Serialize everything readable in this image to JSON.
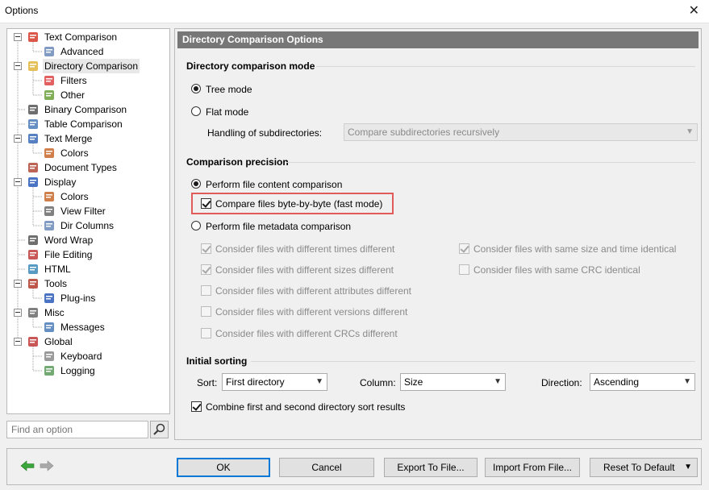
{
  "window": {
    "title": "Options",
    "close_glyph": "✕"
  },
  "tree": {
    "items": [
      {
        "label": "Text Comparison",
        "icon": "text-comparison-icon"
      },
      {
        "label": "Advanced",
        "icon": "advanced-settings-icon"
      },
      {
        "label": "Directory Comparison",
        "icon": "directory-comparison-icon",
        "selected": true
      },
      {
        "label": "Filters",
        "icon": "filter-icon"
      },
      {
        "label": "Other",
        "icon": "other-folder-icon"
      },
      {
        "label": "Binary Comparison",
        "icon": "binary-comparison-icon"
      },
      {
        "label": "Table Comparison",
        "icon": "table-comparison-icon"
      },
      {
        "label": "Text Merge",
        "icon": "text-merge-icon"
      },
      {
        "label": "Colors",
        "icon": "palette-icon"
      },
      {
        "label": "Document Types",
        "icon": "document-types-icon"
      },
      {
        "label": "Display",
        "icon": "display-monitor-icon"
      },
      {
        "label": "Colors",
        "icon": "palette-icon"
      },
      {
        "label": "View Filter",
        "icon": "view-filter-icon"
      },
      {
        "label": "Dir Columns",
        "icon": "dir-columns-icon"
      },
      {
        "label": "Word Wrap",
        "icon": "word-wrap-icon"
      },
      {
        "label": "File Editing",
        "icon": "file-editing-icon"
      },
      {
        "label": "HTML",
        "icon": "html-icon"
      },
      {
        "label": "Tools",
        "icon": "tools-icon"
      },
      {
        "label": "Plug-ins",
        "icon": "plugins-icon"
      },
      {
        "label": "Misc",
        "icon": "misc-icon"
      },
      {
        "label": "Messages",
        "icon": "messages-icon"
      },
      {
        "label": "Global",
        "icon": "global-icon"
      },
      {
        "label": "Keyboard",
        "icon": "keyboard-icon"
      },
      {
        "label": "Logging",
        "icon": "logging-icon"
      }
    ]
  },
  "search": {
    "placeholder": "Find an option",
    "icon": "search-icon"
  },
  "panel": {
    "header": "Directory Comparison Options",
    "mode_section": "Directory comparison mode",
    "tree_mode": "Tree mode",
    "flat_mode": "Flat mode",
    "subdirs_label": "Handling of subdirectories:",
    "subdirs_value": "Compare subdirectories recursively",
    "precision_section": "Comparison precision",
    "content_comparison": "Perform file content comparison",
    "byte_by_byte": "Compare files byte-by-byte (fast mode)",
    "metadata_comparison": "Perform file metadata comparison",
    "meta_options": {
      "times": "Consider files with different times different",
      "sizes": "Consider files with different sizes different",
      "attributes": "Consider files with different attributes different",
      "versions": "Consider files with different versions different",
      "crcs": "Consider files with different CRCs different",
      "same_size_time": "Consider files with same size and time identical",
      "same_crc": "Consider files with same CRC identical"
    },
    "sorting_section": "Initial sorting",
    "sort_label": "Sort:",
    "sort_value": "First directory",
    "column_label": "Column:",
    "column_value": "Size",
    "direction_label": "Direction:",
    "direction_value": "Ascending",
    "combine_sort": "Combine first and second directory sort results"
  },
  "buttons": {
    "ok": "OK",
    "cancel": "Cancel",
    "export": "Export To File...",
    "import": "Import From File...",
    "reset": "Reset To Default"
  },
  "colors": {
    "accent": "#0078d7",
    "highlight": "#e25b5b",
    "header_bg": "#777777"
  }
}
